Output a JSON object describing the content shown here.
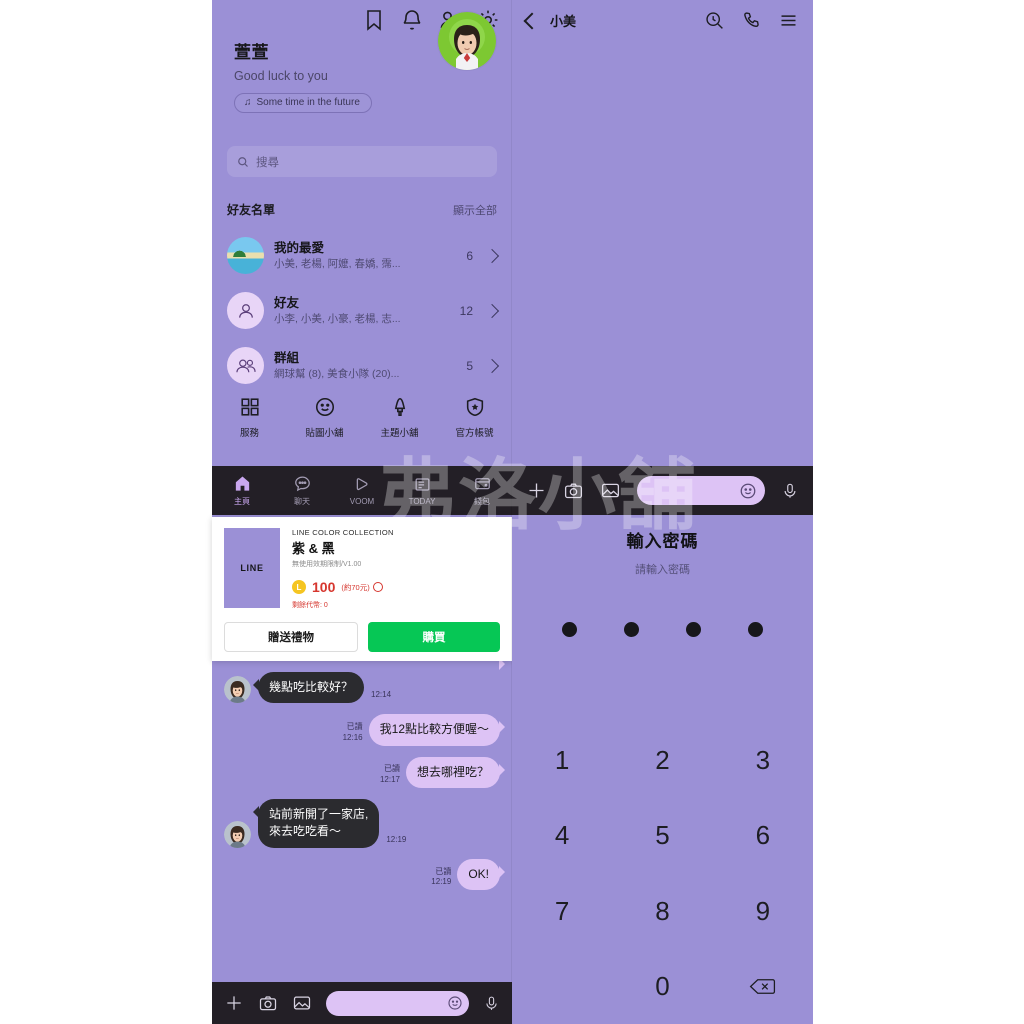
{
  "colors": {
    "app_purple": "#9b90d6",
    "dark_bar": "#231f26",
    "bubble_in": "#2b2b2f",
    "bubble_out": "#ddc3f5",
    "buy_green": "#06c755",
    "price_red": "#d6362e",
    "coin_yellow": "#f5c521"
  },
  "watermark": {
    "text": "弗洛小舖"
  },
  "left_app": {
    "top_icons": [
      {
        "name": "bookmark-icon"
      },
      {
        "name": "bell-icon"
      },
      {
        "name": "add-friend-icon"
      },
      {
        "name": "gear-icon"
      }
    ],
    "profile": {
      "display_name": "萱萱",
      "status_message": "Good luck to you",
      "music_chip": "Some time in the future",
      "music_icon": "music-note-icon",
      "avatar_alt": "user-avatar"
    },
    "search": {
      "placeholder": "搜尋",
      "icon": "search-icon"
    },
    "friends_section": {
      "title": "好友名單",
      "see_all": "顯示全部",
      "rows": [
        {
          "name": "我的最愛",
          "preview": "小美, 老楊, 阿嬤, 春嬌, 霈...",
          "count": "6",
          "avatar": "beach-photo-avatar"
        },
        {
          "name": "好友",
          "preview": "小李, 小美, 小豪, 老楊, 志...",
          "count": "12",
          "avatar": "person-icon"
        },
        {
          "name": "群組",
          "preview": "網球幫 (8), 美食小隊 (20)...",
          "count": "5",
          "avatar": "group-icon"
        }
      ]
    },
    "quick_menu": [
      {
        "label": "服務",
        "icon": "grid-icon"
      },
      {
        "label": "貼圖小舖",
        "icon": "smiley-icon"
      },
      {
        "label": "主題小舖",
        "icon": "lamp-icon"
      },
      {
        "label": "官方帳號",
        "icon": "shield-star-icon"
      }
    ],
    "bottom_nav": [
      {
        "label": "主頁",
        "icon": "home-icon",
        "active": true
      },
      {
        "label": "聊天",
        "icon": "chat-bubble-icon",
        "active": false
      },
      {
        "label": "VOOM",
        "icon": "play-icon",
        "active": false
      },
      {
        "label": "TODAY",
        "icon": "news-icon",
        "active": false
      },
      {
        "label": "錢包",
        "icon": "wallet-icon",
        "active": false
      }
    ]
  },
  "sticker_dialog": {
    "thumb_label": "LINE",
    "kicker": "LINE COLOR COLLECTION",
    "title": "紫 & 黑",
    "subtitle": "無使用效期限制/V1.00",
    "coin_symbol": "L",
    "price": "100",
    "approx": "(約70元)",
    "balance": "剩餘代幣: 0",
    "gift_button": "贈送禮物",
    "buy_button": "購買"
  },
  "chat": {
    "messages": [
      {
        "side": "out",
        "text": "",
        "read": "",
        "time": "12:14",
        "clipped": true
      },
      {
        "side": "in",
        "text": "幾點吃比較好？",
        "time": "12:14"
      },
      {
        "side": "out",
        "text": "我12點比較方便喔～",
        "read": "已讀",
        "time": "12:16"
      },
      {
        "side": "out",
        "text": "想去哪裡吃？",
        "read": "已讀",
        "time": "12:17"
      },
      {
        "side": "in",
        "text": "站前新開了一家店,\n來去吃吃看～",
        "time": "12:19"
      },
      {
        "side": "out",
        "text": "OK!",
        "read": "已讀",
        "time": "12:19"
      }
    ],
    "input_bar": {
      "plus_icon": "plus-icon",
      "camera_icon": "camera-icon",
      "gallery_icon": "gallery-icon",
      "emoji_icon": "smiley-icon",
      "mic_icon": "microphone-icon",
      "placeholder": ""
    }
  },
  "right_app": {
    "header": {
      "back_icon": "chevron-left-icon",
      "title": "小美",
      "actions": [
        {
          "name": "search-time-icon"
        },
        {
          "name": "phone-icon"
        },
        {
          "name": "menu-icon"
        }
      ]
    },
    "input_bar": {
      "plus_icon": "plus-icon",
      "camera_icon": "camera-icon",
      "gallery_icon": "gallery-icon",
      "emoji_icon": "smiley-icon",
      "mic_icon": "microphone-icon",
      "placeholder": ""
    },
    "passcode": {
      "title": "輸入密碼",
      "subtitle": "請輸入密碼",
      "dots": 4,
      "keys": [
        "1",
        "2",
        "3",
        "4",
        "5",
        "6",
        "7",
        "8",
        "9",
        "",
        "0",
        "backspace"
      ],
      "backspace_icon": "backspace-icon"
    }
  }
}
